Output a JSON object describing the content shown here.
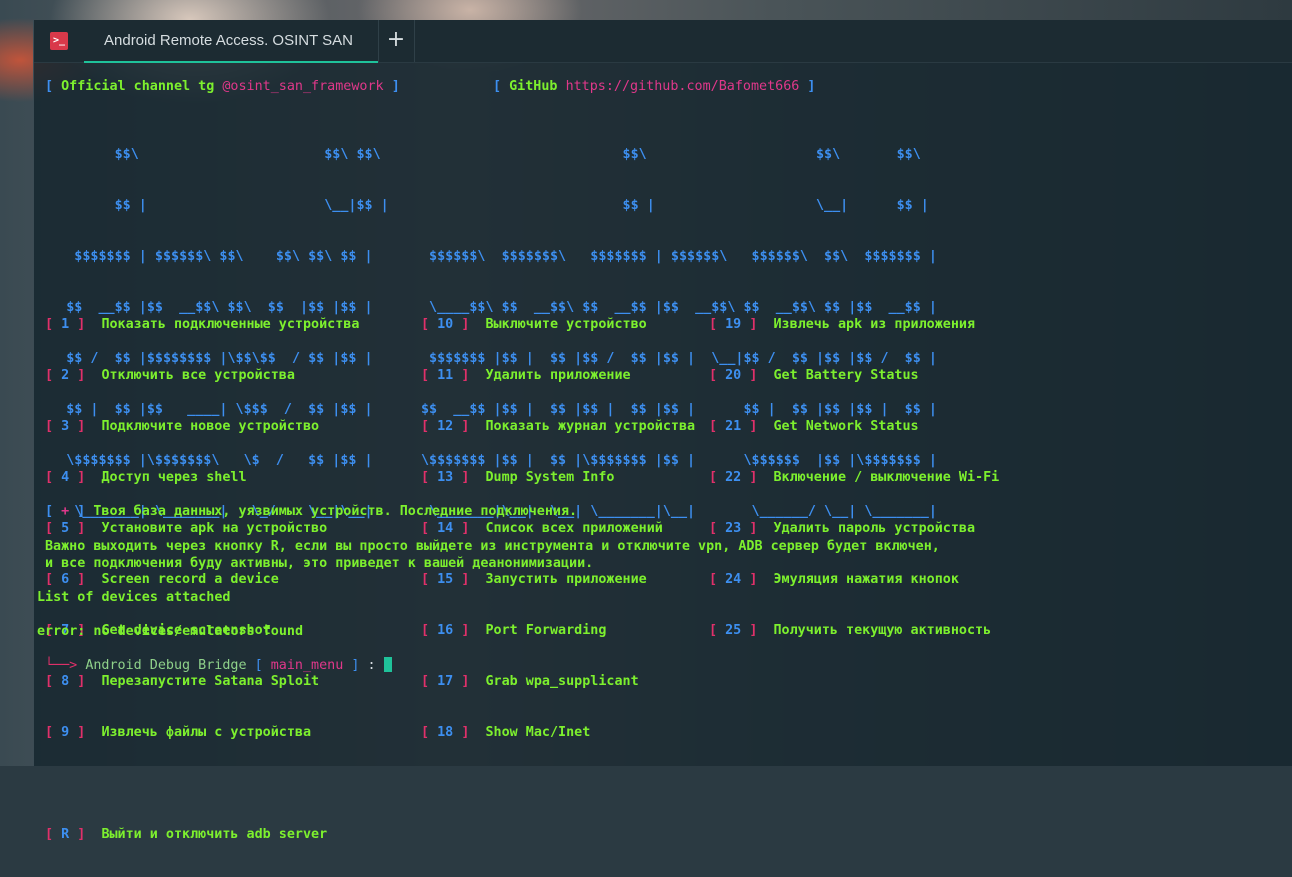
{
  "window": {
    "tab_title": "Android Remote Access. OSINT SAN",
    "terminal_icon": ">_",
    "new_tab_symbol": "+"
  },
  "header": {
    "channel_open": "[",
    "channel_label": "Official channel tg",
    "channel_handle": "@osint_san_framework",
    "channel_close": "]",
    "github_open": "[",
    "github_label": "GitHub",
    "github_url": "https://github.com/Bafomet666",
    "github_close": "]"
  },
  "banner": [
    "          $$\\                       $$\\ $$\\                              $$\\                     $$\\       $$\\ ",
    "          $$ |                      \\__|$$ |                             $$ |                    \\__|      $$ |",
    "     $$$$$$$ | $$$$$$\\ $$\\    $$\\ $$\\ $$ |       $$$$$$\\  $$$$$$$\\   $$$$$$$ | $$$$$$\\   $$$$$$\\  $$\\  $$$$$$$ |",
    "    $$  __$$ |$$  __$$\\ $$\\  $$  |$$ |$$ |       \\____$$\\ $$  __$$\\ $$  __$$ |$$  __$$\\ $$  __$$\\ $$ |$$  __$$ |",
    "    $$ /  $$ |$$$$$$$$ |\\$$\\$$  / $$ |$$ |       $$$$$$$ |$$ |  $$ |$$ /  $$ |$$ |  \\__|$$ /  $$ |$$ |$$ /  $$ |",
    "    $$ |  $$ |$$   ____| \\$$$  /  $$ |$$ |      $$  __$$ |$$ |  $$ |$$ |  $$ |$$ |      $$ |  $$ |$$ |$$ |  $$ |",
    "    \\$$$$$$$ |\\$$$$$$$\\   \\$  /   $$ |$$ |      \\$$$$$$$ |$$ |  $$ |\\$$$$$$$ |$$ |      \\$$$$$$  |$$ |\\$$$$$$$ |",
    "     \\_______| \\_______|   \\_/    \\__|\\__|       \\_______|\\__|  \\__| \\_______|\\__|       \\______/ \\__| \\_______|"
  ],
  "menu": {
    "col1": [
      {
        "num": "1",
        "label": "Показать подключенные устройства"
      },
      {
        "num": "2",
        "label": "Отключить все устройства"
      },
      {
        "num": "3",
        "label": "Подключите новое устройство"
      },
      {
        "num": "4",
        "label": "Доступ через shell"
      },
      {
        "num": "5",
        "label": "Установите apk на устройство"
      },
      {
        "num": "6",
        "label": "Screen record a device"
      },
      {
        "num": "7",
        "label": "Get device screenshot"
      },
      {
        "num": "8",
        "label": "Перезапустите Satana Sploit"
      },
      {
        "num": "9",
        "label": "Извлечь файлы с устройства"
      }
    ],
    "col2": [
      {
        "num": "10",
        "label": "Выключите устройство"
      },
      {
        "num": "11",
        "label": "Удалить приложение"
      },
      {
        "num": "12",
        "label": "Показать журнал устройства"
      },
      {
        "num": "13",
        "label": "Dump System Info"
      },
      {
        "num": "14",
        "label": "Список всех приложений"
      },
      {
        "num": "15",
        "label": "Запустить приложение"
      },
      {
        "num": "16",
        "label": "Port Forwarding"
      },
      {
        "num": "17",
        "label": "Grab wpa_supplicant"
      },
      {
        "num": "18",
        "label": "Show Mac/Inet"
      }
    ],
    "col3": [
      {
        "num": "19",
        "label": "Извлечь apk из приложения"
      },
      {
        "num": "20",
        "label": "Get Battery Status"
      },
      {
        "num": "21",
        "label": "Get Network Status"
      },
      {
        "num": "22",
        "label": "Включение / выключение Wi-Fi"
      },
      {
        "num": "23",
        "label": "Удалить пароль устройства"
      },
      {
        "num": "24",
        "label": "Эмуляция нажатия кнопок"
      },
      {
        "num": "25",
        "label": "Получить текущую активность"
      }
    ],
    "exit": {
      "num": "R",
      "label": "Выйти и отключить adb server"
    }
  },
  "info": {
    "plus_marker": "+",
    "db_text": "Твоя база данных, уязвимых устройств. Последние подключения.",
    "warning_line1": "Важно выходить через кнопку R, если вы просто выйдете из инструмента и отключите vpn, ADB сервер будет включен,",
    "warning_line2": "и все подключения буду активны, это приведет к вашей деанонимизации.",
    "devices_header": "List of devices attached",
    "error_text": "error: no devices/emulators found"
  },
  "prompt": {
    "arrow": "└──>",
    "label": "Android Debug Bridge",
    "open": "[",
    "context": "main_menu",
    "close": "]",
    "colon": ":"
  },
  "colors": {
    "accent_teal": "#1fc29a",
    "bracket_red": "#e0306a",
    "number_blue": "#3d8ff0",
    "text_green": "#7df02e",
    "icon_red": "#d9394a"
  }
}
